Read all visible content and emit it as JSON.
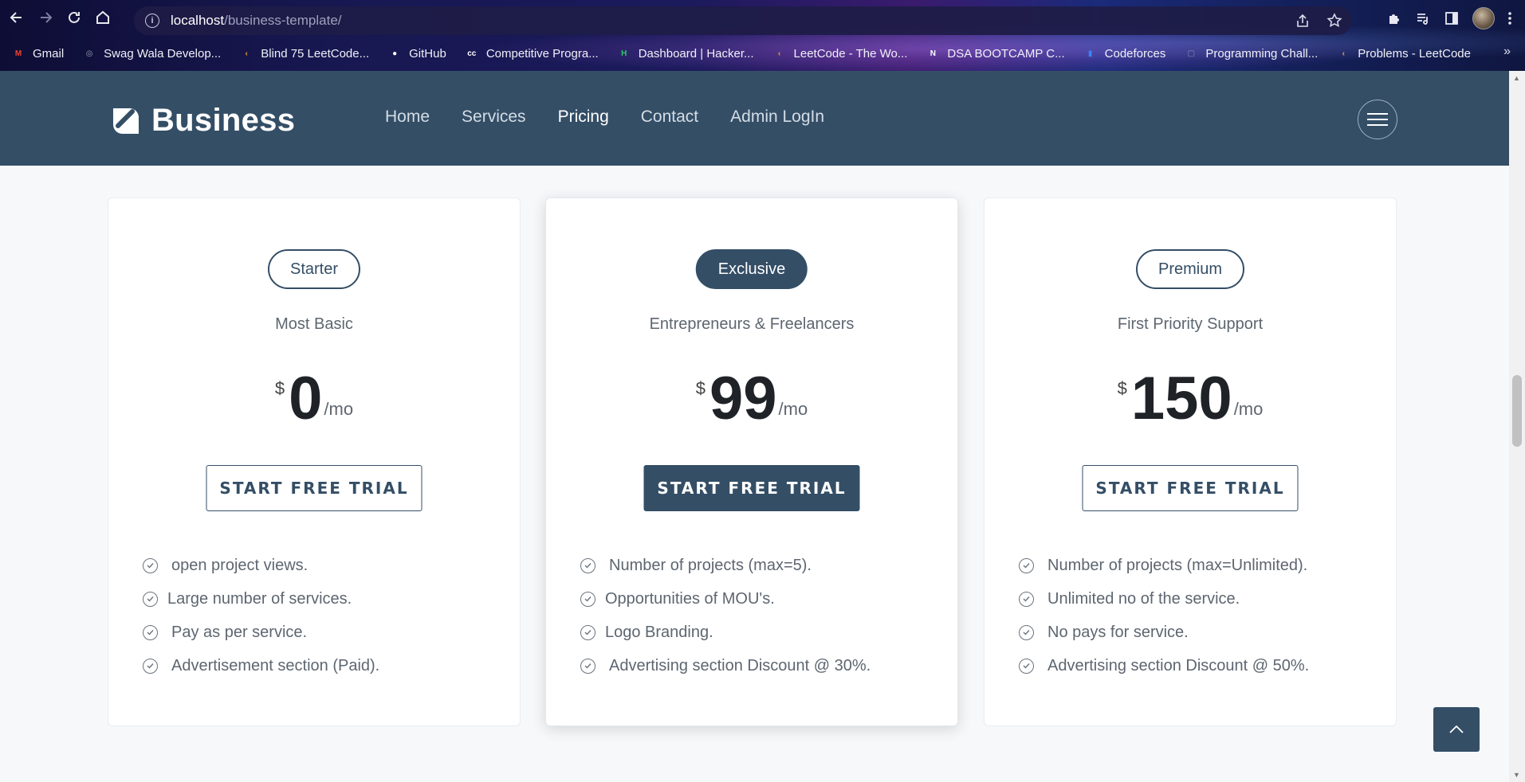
{
  "browser": {
    "url_host": "localhost",
    "url_path": "/business-template/",
    "bookmarks": [
      {
        "label": "Gmail",
        "icon": "gmail-icon",
        "color": "#ea4335"
      },
      {
        "label": "Swag Wala Develop...",
        "icon": "globe-icon",
        "color": "#9aa0b8"
      },
      {
        "label": "Blind 75 LeetCode...",
        "icon": "leetcode-icon",
        "color": "#f0a030"
      },
      {
        "label": "GitHub",
        "icon": "github-icon",
        "color": "#ffffff"
      },
      {
        "label": "Competitive Progra...",
        "icon": "cc-icon",
        "color": "#ffffff"
      },
      {
        "label": "Dashboard | Hacker...",
        "icon": "hackerrank-icon",
        "color": "#2ec866"
      },
      {
        "label": "LeetCode - The Wo...",
        "icon": "leetcode-icon",
        "color": "#f0a030"
      },
      {
        "label": "DSA BOOTCAMP C...",
        "icon": "notion-icon",
        "color": "#ffffff"
      },
      {
        "label": "Codeforces",
        "icon": "codeforces-icon",
        "color": "#3b82f6"
      },
      {
        "label": "Programming Chall...",
        "icon": "page-icon",
        "color": "#8a8aa0"
      },
      {
        "label": "Problems - LeetCode",
        "icon": "leetcode-icon",
        "color": "#f0a030"
      }
    ],
    "more_label": "»"
  },
  "header": {
    "brand": "Business",
    "nav": [
      {
        "label": "Home",
        "active": false
      },
      {
        "label": "Services",
        "active": false
      },
      {
        "label": "Pricing",
        "active": true
      },
      {
        "label": "Contact",
        "active": false
      },
      {
        "label": "Admin LogIn",
        "active": false
      }
    ]
  },
  "plans": [
    {
      "name": "Starter",
      "subtitle": "Most Basic",
      "currency": "$",
      "price": "0",
      "period": "/mo",
      "cta": "START FREE TRIAL",
      "featured": false,
      "features": [
        "open project views.",
        "Large number of services.",
        "Pay as per service.",
        "Advertisement section (Paid)."
      ]
    },
    {
      "name": "Exclusive",
      "subtitle": "Entrepreneurs & Freelancers",
      "currency": "$",
      "price": "99",
      "period": "/mo",
      "cta": "START FREE TRIAL",
      "featured": true,
      "features": [
        "Number of projects (max=5).",
        "Opportunities of MOU's.",
        "Logo Branding.",
        "Advertising section Discount @ 30%."
      ]
    },
    {
      "name": "Premium",
      "subtitle": "First Priority Support",
      "currency": "$",
      "price": "150",
      "period": "/mo",
      "cta": "START FREE TRIAL",
      "featured": false,
      "features": [
        "Number of projects (max=Unlimited).",
        "Unlimited no of the service.",
        "No pays for service.",
        "Advertising section Discount @ 50%."
      ]
    }
  ],
  "colors": {
    "brand": "#344e66",
    "text_muted": "#5d6670",
    "page_bg": "#f6f8fa"
  }
}
